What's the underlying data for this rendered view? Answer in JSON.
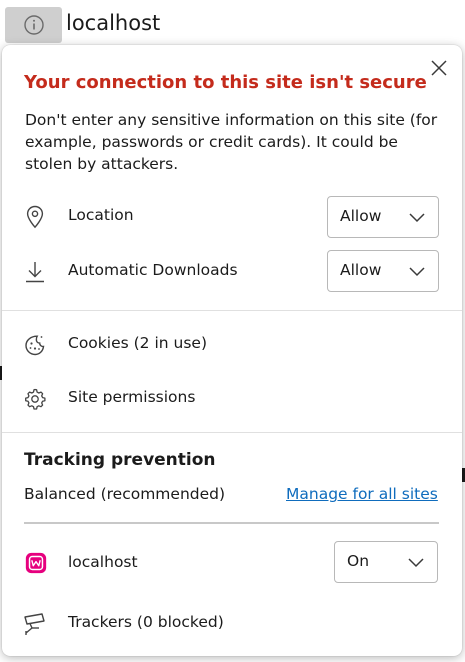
{
  "address_bar": {
    "url": "localhost",
    "info_icon": "info-circle-icon"
  },
  "flyout": {
    "title": "Your connection to this site isn't secure",
    "description": "Don't enter any sensitive information on this site (for example, passwords or credit cards). It could be stolen by attackers.",
    "close_icon": "close-icon",
    "permissions": [
      {
        "label": "Location",
        "icon": "location-pin-icon",
        "value": "Allow"
      },
      {
        "label": "Automatic Downloads",
        "icon": "download-icon",
        "value": "Allow"
      }
    ],
    "links": [
      {
        "label": "Cookies (2 in use)",
        "icon": "cookie-icon"
      },
      {
        "label": "Site permissions",
        "icon": "gear-icon"
      }
    ],
    "tracking": {
      "title": "Tracking prevention",
      "level": "Balanced (recommended)",
      "manage_link": "Manage for all sites",
      "site_label": "localhost",
      "site_icon": "wampserver-icon",
      "site_value": "On",
      "trackers": "Trackers (0 blocked)",
      "trackers_icon": "camera-icon"
    },
    "colors": {
      "title": "#c42b1c",
      "link": "#0f6cbd",
      "site_icon": "#e6007e"
    }
  }
}
